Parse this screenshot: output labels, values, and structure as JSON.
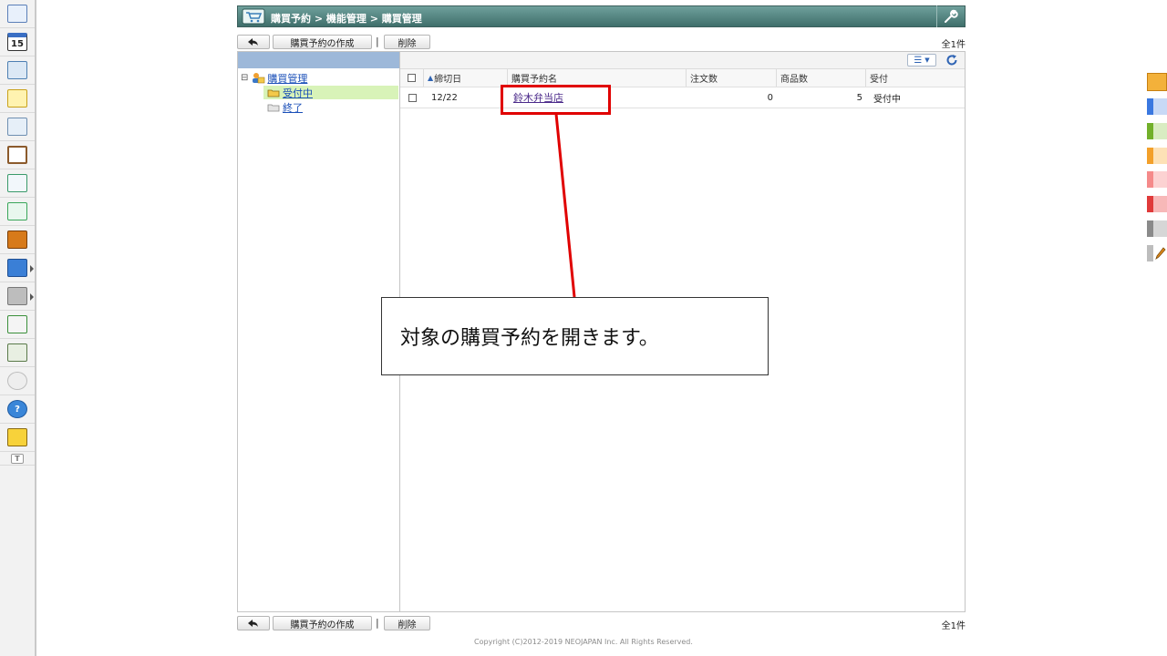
{
  "app": {
    "breadcrumb": "購買予約 > 機能管理 > 購買管理"
  },
  "toolbar": {
    "back_label": "",
    "create_label": "購買予約の作成",
    "separator": "|",
    "delete_label": "削除",
    "count": "全1件"
  },
  "tree": {
    "root": "購買管理",
    "items": [
      {
        "label": "受付中"
      },
      {
        "label": "終了"
      }
    ],
    "expander": "⊟"
  },
  "grid": {
    "columns": [
      "締切日",
      "購買予約名",
      "注文数",
      "商品数",
      "受付"
    ],
    "rows": [
      {
        "deadline": "12/22",
        "name": "鈴木弁当店",
        "orders": "0",
        "products": "5",
        "status": "受付中"
      }
    ]
  },
  "launcher": {
    "calendar_day": "15"
  },
  "callout": {
    "text": "対象の購買予約を開きます。"
  },
  "footer": {
    "copyright": "Copyright (C)2012-2019 NEOJAPAN Inc. All Rights Reserved."
  },
  "colors": {
    "title_bar": "#4f7f7b",
    "tree_header": "#9db8d9",
    "selected_row": "#d8f3b8",
    "highlight": "#e00000",
    "strip": [
      "#3a78e0",
      "#72b02a",
      "#f3a02a",
      "#f58a8a",
      "#e03a3a",
      "#8a8a8a"
    ]
  }
}
